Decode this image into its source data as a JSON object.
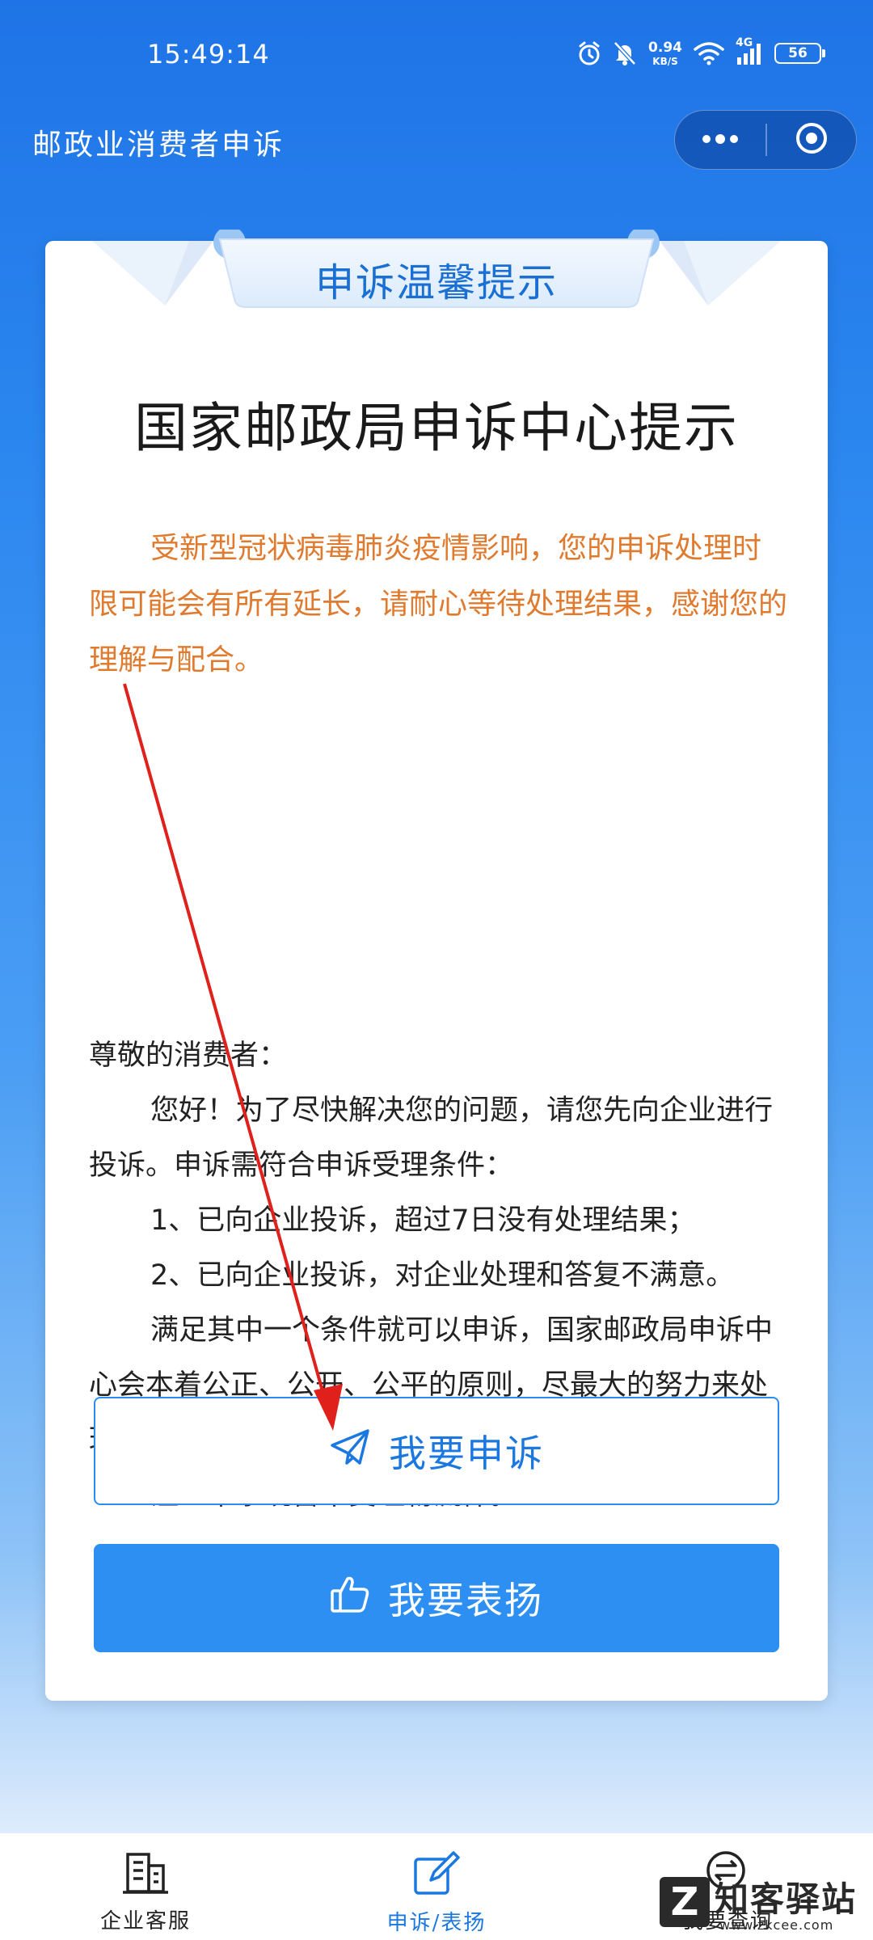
{
  "status_bar": {
    "time": "15:49:14",
    "net_speed": "0.94",
    "net_unit": "KB/S",
    "network": "4G",
    "battery": "56",
    "icons": [
      "alarm-icon",
      "mute-icon",
      "wifi-icon",
      "signal-icon",
      "battery-icon"
    ]
  },
  "header": {
    "title": "邮政业消费者申诉",
    "capsule_icons": [
      "more-icon",
      "close-miniprogram-icon"
    ]
  },
  "card": {
    "ribbon_title": "申诉温馨提示",
    "heading": "国家邮政局申诉中心提示",
    "covid_notice": "受新型冠状病毒肺炎疫情影响，您的申诉处理时限可能会有所有延长，请耐心等待处理结果，感谢您的理解与配合。",
    "salutation": "尊敬的消费者：",
    "intro": "您好！为了尽快解决您的问题，请您先向企业进行投诉。申诉需符合申诉受理条件：",
    "condition_1": "1、已向企业投诉，超过7日没有处理结果；",
    "condition_2": "2、已向企业投诉，对企业处理和答复不满意。",
    "explanation": "满足其中一个条件就可以申诉，国家邮政局申诉中心会本着公正、公开、公平的原则，尽最大的努力来处理您的申诉信息。",
    "note": "注：本系统暂不受理物流件。",
    "complain_button": "我要申诉",
    "praise_button": "我要表扬"
  },
  "tabbar": {
    "tabs": [
      {
        "label": "企业客服",
        "icon": "building-icon"
      },
      {
        "label": "申诉/表扬",
        "icon": "edit-icon"
      },
      {
        "label": "我要查询",
        "icon": "exchange-icon"
      }
    ],
    "active_index": 1
  },
  "watermark": {
    "logo_letter": "Z",
    "text": "知客驿站",
    "url": "www.zkcee.com"
  },
  "colors": {
    "brand_blue": "#2d8ff2",
    "accent_orange": "#e07a2e",
    "annotation_red": "#e0201b"
  }
}
